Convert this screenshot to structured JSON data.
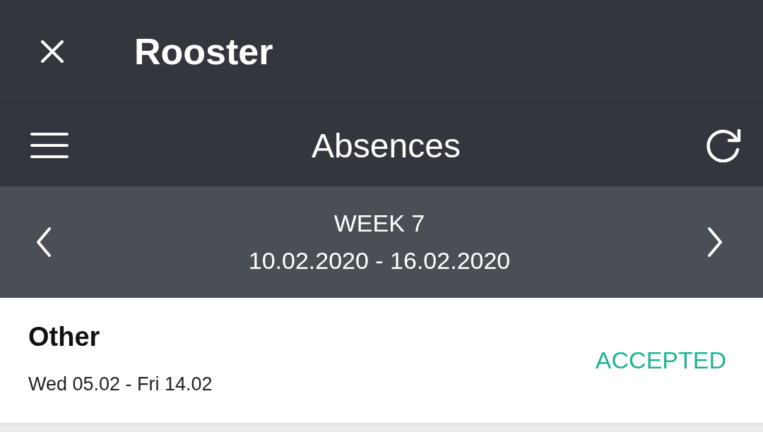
{
  "app_bar": {
    "title": "Rooster"
  },
  "toolbar": {
    "title": "Absences"
  },
  "week_nav": {
    "week": "WEEK 7",
    "range": "10.02.2020 - 16.02.2020"
  },
  "absences": [
    {
      "type": "Other",
      "dates": "Wed 05.02 - Fri 14.02",
      "status": {
        "text": "ACCEPTED",
        "kind": "accepted"
      }
    }
  ]
}
